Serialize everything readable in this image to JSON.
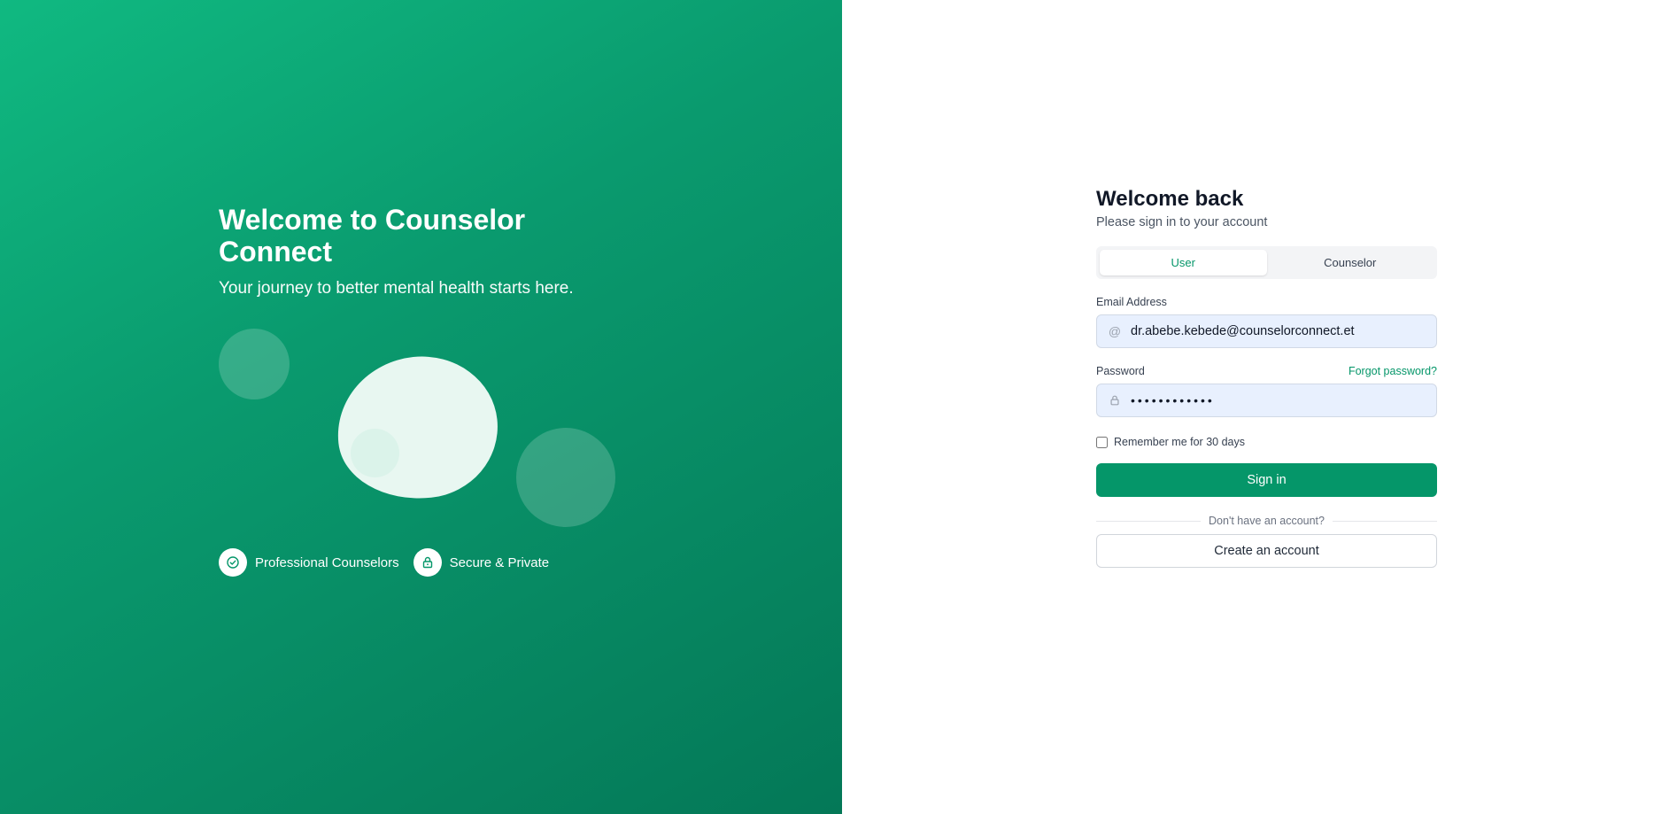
{
  "hero": {
    "title": "Welcome to Counselor Connect",
    "subtitle": "Your journey to better mental health starts here.",
    "features": [
      {
        "label": "Professional Counselors",
        "icon": "check-circle-icon"
      },
      {
        "label": "Secure & Private",
        "icon": "lock-icon"
      }
    ]
  },
  "login": {
    "title": "Welcome back",
    "subtitle": "Please sign in to your account",
    "roles": {
      "user": "User",
      "counselor": "Counselor",
      "selected": "User"
    },
    "email": {
      "label": "Email Address",
      "value": "dr.abebe.kebede@counselorconnect.et",
      "icon": "at-icon"
    },
    "password": {
      "label": "Password",
      "value": "••••••••••••",
      "icon": "lock-icon",
      "forgot_label": "Forgot password?"
    },
    "remember_label": "Remember me for 30 days",
    "remember_checked": false,
    "signin_label": "Sign in",
    "divider_text": "Don't have an account?",
    "create_label": "Create an account"
  },
  "colors": {
    "brand": "#059669",
    "hero_gradient_start": "#10b981",
    "hero_gradient_end": "#047857",
    "input_bg": "#e8f0fe"
  }
}
